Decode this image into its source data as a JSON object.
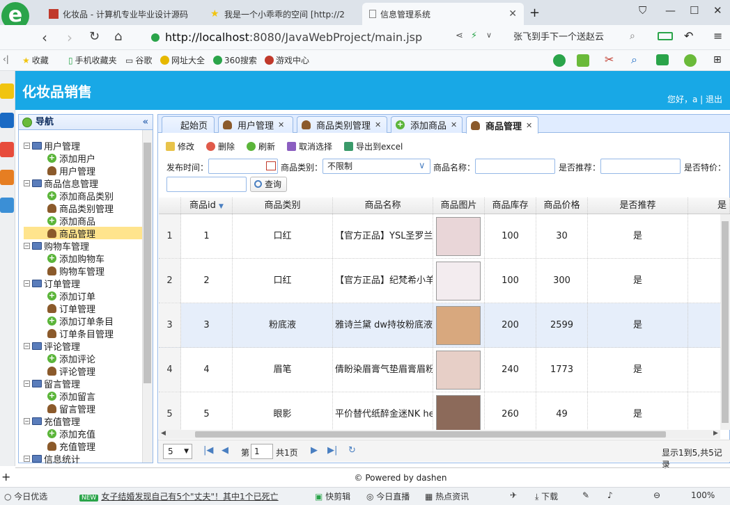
{
  "browser": {
    "tabs": [
      {
        "title": "化妆品 - 计算机专业毕业设计源码"
      },
      {
        "title": "我是一个小乖乖的空间 [http://2"
      },
      {
        "title": "信息管理系统"
      }
    ],
    "new_tab": "+",
    "url_host": "http://localhost",
    "url_rest": ":8080/JavaWebProject/main.jsp",
    "search_text": "张飞到手下一个送赵云",
    "bookmarks": [
      "收藏",
      "手机收藏夹",
      "谷歌",
      "网址大全",
      "360搜索",
      "游戏中心"
    ]
  },
  "app": {
    "title": "化妆品销售",
    "greeting": "您好，a | 退出"
  },
  "nav": {
    "title": "导航",
    "collapse": "«",
    "tree": [
      {
        "label": "用户管理",
        "type": "group"
      },
      {
        "label": "添加用户",
        "type": "add"
      },
      {
        "label": "用户管理",
        "type": "user"
      },
      {
        "label": "商品信息管理",
        "type": "group"
      },
      {
        "label": "添加商品类别",
        "type": "add"
      },
      {
        "label": "商品类别管理",
        "type": "user"
      },
      {
        "label": "添加商品",
        "type": "add"
      },
      {
        "label": "商品管理",
        "type": "user",
        "selected": true
      },
      {
        "label": "购物车管理",
        "type": "group"
      },
      {
        "label": "添加购物车",
        "type": "add"
      },
      {
        "label": "购物车管理",
        "type": "user"
      },
      {
        "label": "订单管理",
        "type": "group"
      },
      {
        "label": "添加订单",
        "type": "add"
      },
      {
        "label": "订单管理",
        "type": "user"
      },
      {
        "label": "添加订单条目",
        "type": "add"
      },
      {
        "label": "订单条目管理",
        "type": "user"
      },
      {
        "label": "评论管理",
        "type": "group"
      },
      {
        "label": "添加评论",
        "type": "add"
      },
      {
        "label": "评论管理",
        "type": "user"
      },
      {
        "label": "留言管理",
        "type": "group"
      },
      {
        "label": "添加留言",
        "type": "add"
      },
      {
        "label": "留言管理",
        "type": "user"
      },
      {
        "label": "充值管理",
        "type": "group"
      },
      {
        "label": "添加充值",
        "type": "add"
      },
      {
        "label": "充值管理",
        "type": "user"
      },
      {
        "label": "信息统计",
        "type": "group"
      }
    ]
  },
  "content_tabs": [
    {
      "label": "起始页",
      "closable": false
    },
    {
      "label": "用户管理",
      "closable": true
    },
    {
      "label": "商品类别管理",
      "closable": true
    },
    {
      "label": "添加商品",
      "closable": true
    },
    {
      "label": "商品管理",
      "closable": true,
      "active": true
    }
  ],
  "toolbar": {
    "edit": "修改",
    "delete": "删除",
    "refresh": "刷新",
    "deselect": "取消选择",
    "export": "导出到excel"
  },
  "filters": {
    "publish_time_label": "发布时间：",
    "category_label": "商品类别：",
    "category_value": "不限制",
    "name_label": "商品名称：",
    "recommend_label": "是否推荐：",
    "special_label": "是否特价：",
    "query": "查询"
  },
  "table": {
    "columns": [
      "商品id",
      "商品类别",
      "商品名称",
      "商品图片",
      "商品库存",
      "商品价格",
      "是否推荐",
      "是"
    ],
    "rows": [
      {
        "rn": "1",
        "id": "1",
        "cat": "口红",
        "name": "【官方正品】YSL圣罗兰",
        "stock": "100",
        "price": "30",
        "rec": "是"
      },
      {
        "rn": "2",
        "id": "2",
        "cat": "口红",
        "name": "【官方正品】纪梵希小羊",
        "stock": "100",
        "price": "300",
        "rec": "是"
      },
      {
        "rn": "3",
        "id": "3",
        "cat": "粉底液",
        "name": "雅诗兰黛 dw持妆粉底液",
        "stock": "200",
        "price": "2599",
        "rec": "是"
      },
      {
        "rn": "4",
        "id": "4",
        "cat": "眉笔",
        "name": "倩盼染眉膏气垫眉膏眉粉",
        "stock": "240",
        "price": "1773",
        "rec": "是"
      },
      {
        "rn": "5",
        "id": "5",
        "cat": "眼影",
        "name": "平价替代纸醉金迷NK he",
        "stock": "260",
        "price": "49",
        "rec": "是"
      }
    ]
  },
  "pager": {
    "size": "5",
    "page_label": "第",
    "page": "1",
    "total": "共1页",
    "summary": "显示1到5,共5记录"
  },
  "footer": "© Powered by dashen",
  "status": {
    "items": [
      "今日优选",
      "女子结婚发现自己有5个\"丈夫\"！其中1个已死亡",
      "快剪辑",
      "今日直播",
      "热点资讯",
      "下载",
      "100%"
    ],
    "new_badge": "NEW"
  },
  "colors": {
    "header": "#18a8e6",
    "border": "#95b8e7",
    "selected": "#ffe48d",
    "highlight_row": "#e6eefa"
  }
}
